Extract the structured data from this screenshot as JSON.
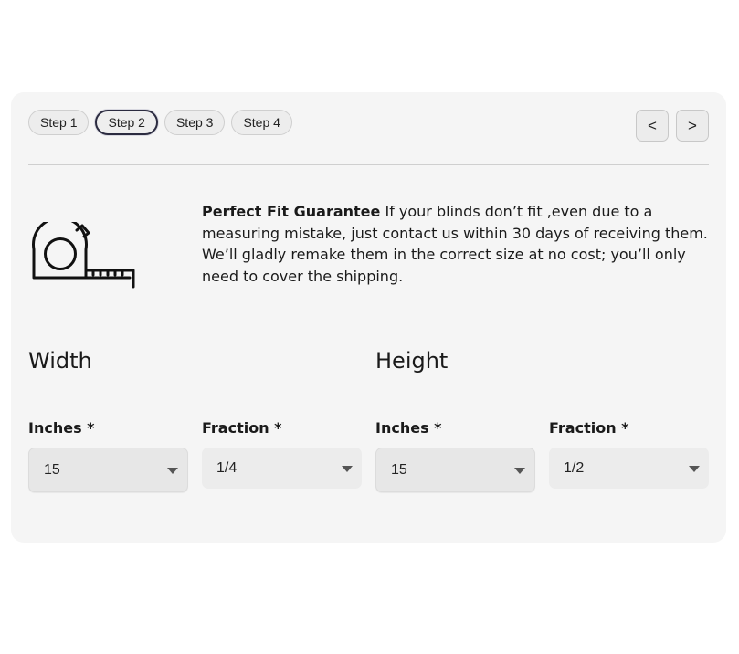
{
  "steps": {
    "items": [
      {
        "label": "Step 1"
      },
      {
        "label": "Step 2"
      },
      {
        "label": "Step 3"
      },
      {
        "label": "Step 4"
      }
    ],
    "active_index": 1
  },
  "nav": {
    "prev_label": "<",
    "next_label": ">"
  },
  "guarantee": {
    "title": "Perfect Fit Guarantee",
    "body": "If your blinds don’t fit ,even due to a measuring mistake, just contact us within 30 days of receiving them. We’ll gladly remake them in the correct size at no cost; you’ll only need to cover the shipping.",
    "icon": "tape-measure-icon"
  },
  "width": {
    "title": "Width",
    "inches_label": "Inches *",
    "inches_value": "15",
    "fraction_label": "Fraction *",
    "fraction_value": "1/4"
  },
  "height": {
    "title": "Height",
    "inches_label": "Inches *",
    "inches_value": "15",
    "fraction_label": "Fraction *",
    "fraction_value": "1/2"
  }
}
